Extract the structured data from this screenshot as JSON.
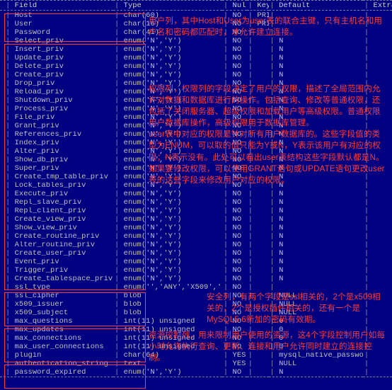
{
  "headers": {
    "field": "Field",
    "type": "Type",
    "null": "Null",
    "key": "Key",
    "default": "Default",
    "extra": "Extra"
  },
  "sections": [
    {
      "rows": [
        {
          "f": "Host",
          "t": "char(60)",
          "n": "NO",
          "k": "PRI",
          "d": ""
        },
        {
          "f": "User",
          "t": "char(16)",
          "n": "NO",
          "k": "PRI",
          "d": ""
        },
        {
          "f": "Password",
          "t": "char(41)",
          "n": "NO",
          "k": "",
          "d": ""
        }
      ]
    },
    {
      "rows": [
        {
          "f": "Select_priv",
          "t": "enum('N','Y')",
          "n": "NO",
          "k": "",
          "d": "N"
        },
        {
          "f": "Insert_priv",
          "t": "enum('N','Y')",
          "n": "NO",
          "k": "",
          "d": "N"
        },
        {
          "f": "Update_priv",
          "t": "enum('N','Y')",
          "n": "NO",
          "k": "",
          "d": "N"
        },
        {
          "f": "Delete_priv",
          "t": "enum('N','Y')",
          "n": "NO",
          "k": "",
          "d": "N"
        },
        {
          "f": "Create_priv",
          "t": "enum('N','Y')",
          "n": "NO",
          "k": "",
          "d": "N"
        },
        {
          "f": "Drop_priv",
          "t": "enum('N','Y')",
          "n": "NO",
          "k": "",
          "d": "N"
        },
        {
          "f": "Reload_priv",
          "t": "enum('N','Y')",
          "n": "NO",
          "k": "",
          "d": "N"
        },
        {
          "f": "Shutdown_priv",
          "t": "enum('N','Y')",
          "n": "NO",
          "k": "",
          "d": "N"
        },
        {
          "f": "Process_priv",
          "t": "enum('N','Y')",
          "n": "NO",
          "k": "",
          "d": "N"
        },
        {
          "f": "File_priv",
          "t": "enum('N','Y')",
          "n": "NO",
          "k": "",
          "d": "N"
        },
        {
          "f": "Grant_priv",
          "t": "enum('N','Y')",
          "n": "NO",
          "k": "",
          "d": "N"
        },
        {
          "f": "References_priv",
          "t": "enum('N','Y')",
          "n": "NO",
          "k": "",
          "d": "N"
        },
        {
          "f": "Index_priv",
          "t": "enum('N','Y')",
          "n": "NO",
          "k": "",
          "d": "N"
        },
        {
          "f": "Alter_priv",
          "t": "enum('N','Y')",
          "n": "NO",
          "k": "",
          "d": "N"
        },
        {
          "f": "Show_db_priv",
          "t": "enum('N','Y')",
          "n": "NO",
          "k": "",
          "d": "N"
        },
        {
          "f": "Super_priv",
          "t": "enum('N','Y')",
          "n": "NO",
          "k": "",
          "d": "N"
        },
        {
          "f": "Create_tmp_table_priv",
          "t": "enum('N','Y')",
          "n": "NO",
          "k": "",
          "d": "N"
        },
        {
          "f": "Lock_tables_priv",
          "t": "enum('N','Y')",
          "n": "NO",
          "k": "",
          "d": "N"
        },
        {
          "f": "Execute_priv",
          "t": "enum('N','Y')",
          "n": "NO",
          "k": "",
          "d": "N"
        },
        {
          "f": "Repl_slave_priv",
          "t": "enum('N','Y')",
          "n": "NO",
          "k": "",
          "d": "N"
        },
        {
          "f": "Repl_client_priv",
          "t": "enum('N','Y')",
          "n": "NO",
          "k": "",
          "d": "N"
        },
        {
          "f": "Create_view_priv",
          "t": "enum('N','Y')",
          "n": "NO",
          "k": "",
          "d": "N"
        },
        {
          "f": "Show_view_priv",
          "t": "enum('N','Y')",
          "n": "NO",
          "k": "",
          "d": "N"
        },
        {
          "f": "Create_routine_priv",
          "t": "enum('N','Y')",
          "n": "NO",
          "k": "",
          "d": "N"
        },
        {
          "f": "Alter_routine_priv",
          "t": "enum('N','Y')",
          "n": "NO",
          "k": "",
          "d": "N"
        },
        {
          "f": "Create_user_priv",
          "t": "enum('N','Y')",
          "n": "NO",
          "k": "",
          "d": "N"
        },
        {
          "f": "Event_priv",
          "t": "enum('N','Y')",
          "n": "NO",
          "k": "",
          "d": "N"
        },
        {
          "f": "Trigger_priv",
          "t": "enum('N','Y')",
          "n": "NO",
          "k": "",
          "d": "N"
        },
        {
          "f": "Create_tablespace_priv",
          "t": "enum('N','Y')",
          "n": "NO",
          "k": "",
          "d": "N"
        }
      ]
    },
    {
      "rows": [
        {
          "f": "ssl_type",
          "t": "enum('','ANY','X509','SPECIFIED')",
          "n": "NO",
          "k": "",
          "d": ""
        },
        {
          "f": "ssl_cipher",
          "t": "blob",
          "n": "NO",
          "k": "",
          "d": "NULL"
        },
        {
          "f": "x509_issuer",
          "t": "blob",
          "n": "NO",
          "k": "",
          "d": "NULL"
        },
        {
          "f": "x509_subject",
          "t": "blob",
          "n": "NO",
          "k": "",
          "d": "NULL"
        }
      ]
    },
    {
      "rows": [
        {
          "f": "max_questions",
          "t": "int(11) unsigned",
          "n": "NO",
          "k": "",
          "d": "0"
        },
        {
          "f": "max_updates",
          "t": "int(11) unsigned",
          "n": "NO",
          "k": "",
          "d": "0"
        },
        {
          "f": "max_connections",
          "t": "int(11) unsigned",
          "n": "NO",
          "k": "",
          "d": "0"
        },
        {
          "f": "max_user_connections",
          "t": "int(11) unsigned",
          "n": "NO",
          "k": "",
          "d": "0"
        }
      ]
    },
    {
      "rows": [
        {
          "f": "plugin",
          "t": "char(64)",
          "n": "YES",
          "k": "",
          "d": "mysql_native_password"
        },
        {
          "f": "authentication_string",
          "t": "text",
          "n": "YES",
          "k": "",
          "d": "NULL"
        },
        {
          "f": "password_expired",
          "t": "enum('N','Y')",
          "n": "NO",
          "k": "",
          "d": "N"
        }
      ]
    }
  ],
  "annotations": {
    "users": "用户列，其中Host和User为user表的联合主键，只有主机名和用户名和密码都匹配时，才允许建立连接。",
    "privs": "权限列，权限列的字段决定了用户的权限，描述了全局范围内允许对数据和数据库进行的操作。包括查询、修改等普通权限，还包括了关闭服务器、超级权限和加载用户等高级权限。普通权限用户数据库操作，高级权限用于数据库管理。\nuser表中对应的权限是针对所有用户数据库的。这些字段值的类型为ENUM，可以取的值只能为Y或N，Y表示该用户有对应的权限；N表示没有。此处可以看出user表结构这些字段默认都是N。如果要修改权限，可以使用GRANT语句或UPDATE语句更改user表的这些字段来修改用户对应的权限。",
    "ssl": "安全列，有两个字段是ssl相关的，2个是x509相关的，2个是授权插件相关的，还有一个是MySQL5.6新加的密码有效期。",
    "limits": "资源控制列，用来限制用户使用的资源，这4个字段控制用户如每小时允许执行查询、更新、连接和用户允许同时建立的连接控制。"
  }
}
